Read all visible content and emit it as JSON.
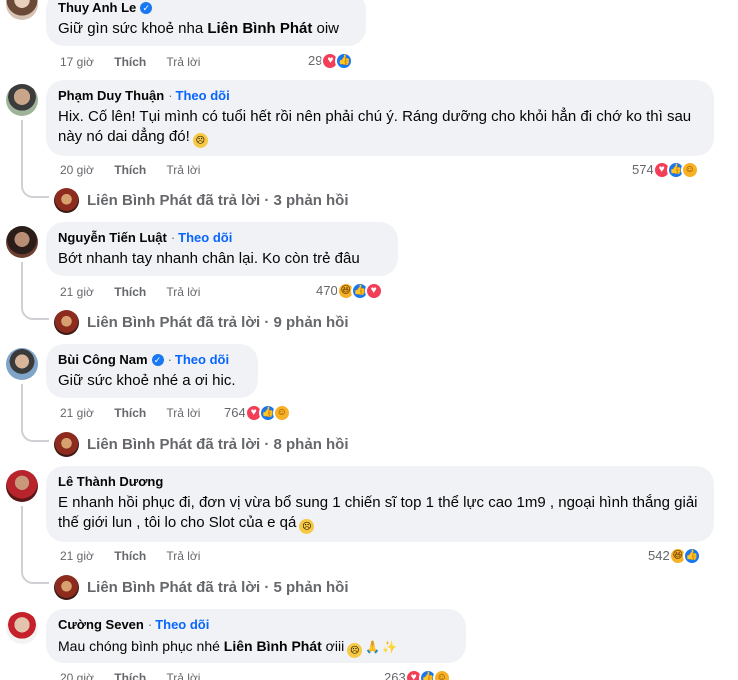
{
  "comments": [
    {
      "name": "Thuy Anh Le",
      "verified": true,
      "follow": "",
      "text_plain": "Giữ gìn sức khoẻ nha ",
      "mention": "Liên Bình Phát",
      "text_after": " oiw",
      "time": "17 giờ",
      "like_label": "Thích",
      "reply_label": "Trả lời",
      "reaction_count": "29",
      "reactions": [
        "love",
        "like"
      ]
    },
    {
      "name": "Phạm Duy Thuận",
      "follow": "Theo dõi",
      "text": "Hix. Cố lên! Tụi mình có tuổi hết rồi nên phải chú ý. Ráng dưỡng cho khỏi hẳn đi chớ ko thì sau này nó dai dẳng đó!",
      "time": "20 giờ",
      "like_label": "Thích",
      "reply_label": "Trả lời",
      "reaction_count": "574",
      "reactions": [
        "love",
        "like",
        "care"
      ],
      "replies_text": "Liên Bình Phát đã trả lời · 3 phản hồi"
    },
    {
      "name": "Nguyễn Tiến Luật",
      "follow": "Theo dõi",
      "text": "Bớt nhanh tay nhanh chân lại. Ko còn trẻ đâu",
      "time": "21 giờ",
      "like_label": "Thích",
      "reply_label": "Trả lời",
      "reaction_count": "470",
      "reactions": [
        "haha",
        "like",
        "love"
      ],
      "replies_text": "Liên Bình Phát đã trả lời · 9 phản hồi"
    },
    {
      "name": "Bùi Công Nam",
      "verified": true,
      "follow": "Theo dõi",
      "text": "Giữ sức khoẻ nhé a ơi hic.",
      "time": "21 giờ",
      "like_label": "Thích",
      "reply_label": "Trả lời",
      "reaction_count": "764",
      "reactions": [
        "love",
        "like",
        "care"
      ],
      "replies_text": "Liên Bình Phát đã trả lời · 8 phản hồi"
    },
    {
      "name": "Lê Thành Dương",
      "follow": "",
      "text": "E nhanh hồi phục đi, đơn vị vừa bổ sung 1 chiến sĩ top 1 thể lực cao 1m9 , ngoại hình thắng giải thế giới lun , tôi lo cho Slot của e qá",
      "time": "21 giờ",
      "like_label": "Thích",
      "reply_label": "Trả lời",
      "reaction_count": "542",
      "reactions": [
        "haha",
        "like"
      ],
      "replies_text": "Liên Bình Phát đã trả lời · 5 phản hồi"
    },
    {
      "name": "Cường Seven",
      "follow": "Theo dõi",
      "text_plain": "Mau chóng bình phục nhé ",
      "mention": "Liên Bình Phát",
      "text_after": " ơiii",
      "time": "20 giờ",
      "like_label": "Thích",
      "reply_label": "Trả lời",
      "reaction_count": "263",
      "reactions": [
        "love",
        "like",
        "care"
      ]
    }
  ],
  "colors": {
    "link": "#0866ff",
    "secondary": "#65676b",
    "bubble": "#f0f2f5",
    "like": "#1877f2",
    "love": "#f33e58"
  }
}
